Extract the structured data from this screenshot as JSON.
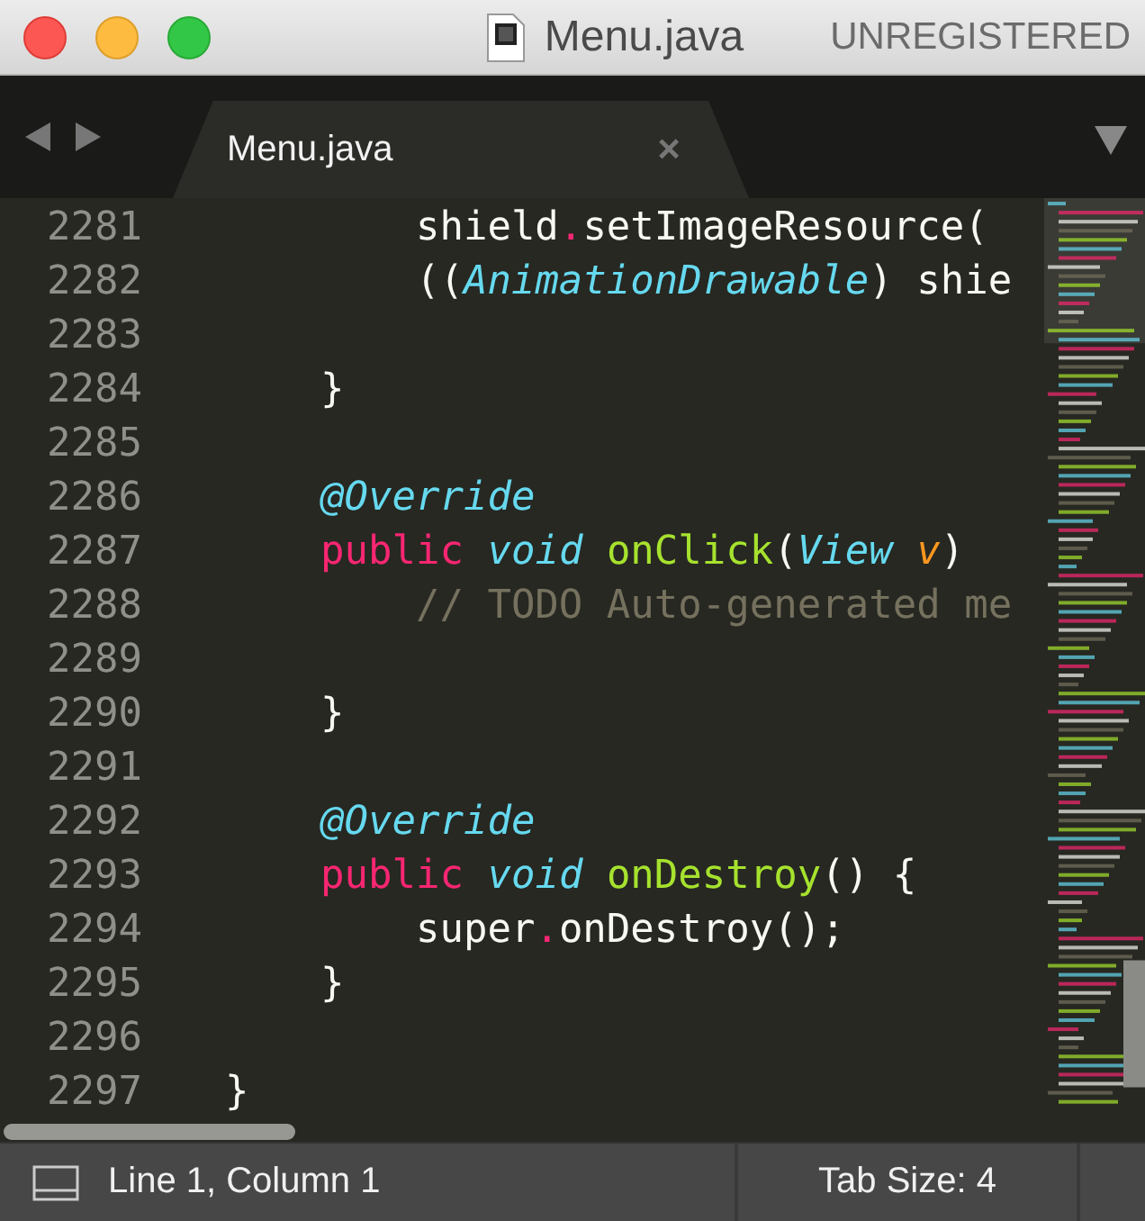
{
  "window": {
    "title": "Menu.java",
    "badge": "UNREGISTERED"
  },
  "tabs": [
    {
      "label": "Menu.java",
      "selected": true,
      "close": "×"
    }
  ],
  "editor": {
    "lines": [
      {
        "number": "2281",
        "tokens": [
          {
            "t": "        shield",
            "kind": "plain"
          },
          {
            "t": ".",
            "kind": "op"
          },
          {
            "t": "setImageResource(",
            "kind": "plain"
          }
        ]
      },
      {
        "number": "2282",
        "tokens": [
          {
            "t": "        ((",
            "kind": "plain"
          },
          {
            "t": "AnimationDrawable",
            "kind": "type"
          },
          {
            "t": ") shie",
            "kind": "plain"
          }
        ]
      },
      {
        "number": "2283"
      },
      {
        "number": "2284",
        "tokens": [
          {
            "t": "    }",
            "kind": "plain"
          }
        ]
      },
      {
        "number": "2285"
      },
      {
        "number": "2286",
        "tokens": [
          {
            "t": "    @Override",
            "kind": "type"
          }
        ]
      },
      {
        "number": "2287",
        "tokens": [
          {
            "t": "    public ",
            "kind": "op"
          },
          {
            "t": "void ",
            "kind": "type"
          },
          {
            "t": "onClick",
            "kind": "func"
          },
          {
            "t": "(",
            "kind": "plain"
          },
          {
            "t": "View ",
            "kind": "type"
          },
          {
            "t": "v",
            "kind": "param"
          },
          {
            "t": ")",
            "kind": "plain"
          }
        ]
      },
      {
        "number": "2288",
        "tokens": [
          {
            "t": "        // TODO Auto-generated me",
            "kind": "comment"
          }
        ]
      },
      {
        "number": "2289"
      },
      {
        "number": "2290",
        "tokens": [
          {
            "t": "    }",
            "kind": "plain"
          }
        ]
      },
      {
        "number": "2291"
      },
      {
        "number": "2292",
        "tokens": [
          {
            "t": "    @Override",
            "kind": "type"
          }
        ]
      },
      {
        "number": "2293",
        "tokens": [
          {
            "t": "    public ",
            "kind": "op"
          },
          {
            "t": "void ",
            "kind": "type"
          },
          {
            "t": "onDestroy",
            "kind": "func"
          },
          {
            "t": "() {",
            "kind": "plain"
          }
        ]
      },
      {
        "number": "2294",
        "tokens": [
          {
            "t": "        super",
            "kind": "plain"
          },
          {
            "t": ".",
            "kind": "op"
          },
          {
            "t": "onDestroy();",
            "kind": "plain"
          }
        ]
      },
      {
        "number": "2295",
        "tokens": [
          {
            "t": "    }",
            "kind": "plain"
          }
        ]
      },
      {
        "number": "2296"
      },
      {
        "number": "2297",
        "tokens": [
          {
            "t": "}",
            "kind": "plain"
          }
        ]
      }
    ]
  },
  "status_bar": {
    "position": "Line 1, Column 1",
    "tab_size": "Tab Size: 4"
  }
}
